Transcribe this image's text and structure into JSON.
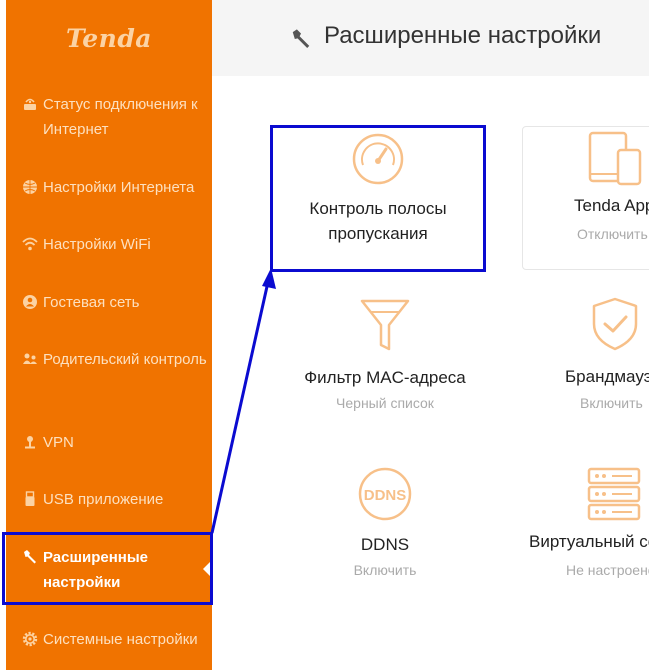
{
  "sidebar": {
    "logo": "Tenda",
    "items": [
      {
        "label": "Статус подключения к Интернет",
        "icon": "connection-status-icon"
      },
      {
        "label": "Настройки Интернета",
        "icon": "globe-icon"
      },
      {
        "label": "Настройки WiFi",
        "icon": "wifi-icon"
      },
      {
        "label": "Гостевая сеть",
        "icon": "guest-network-icon"
      },
      {
        "label": "Родительский контроль",
        "icon": "parental-control-icon"
      },
      {
        "label": "VPN",
        "icon": "vpn-icon"
      },
      {
        "label": "USB приложение",
        "icon": "usb-icon"
      },
      {
        "label": "Расширенные настройки",
        "icon": "wrench-icon",
        "active": true
      },
      {
        "label": "Системные настройки",
        "icon": "gear-icon"
      }
    ]
  },
  "header": {
    "title": "Расширенные настройки",
    "icon": "wrench-icon"
  },
  "tiles": [
    {
      "name_line1": "Контроль полосы",
      "name_line2": "пропускания",
      "status": "",
      "icon": "speedometer-icon"
    },
    {
      "name_line1": "Tenda App",
      "name_line2": "",
      "status": "Отключить",
      "icon": "devices-icon"
    },
    {
      "name_line1": "Фильтр MAC-адреса",
      "name_line2": "",
      "status": "Черный список",
      "icon": "funnel-icon"
    },
    {
      "name_line1": "Брандмауэр",
      "name_line2": "",
      "status": "Включить",
      "icon": "shield-check-icon"
    },
    {
      "name_line1": "DDNS",
      "name_line2": "",
      "status": "Включить",
      "icon": "ddns-icon",
      "icon_text": "DDNS"
    },
    {
      "name_line1": "Виртуальный сервер",
      "name_line2": "",
      "status": "Не настроено",
      "icon": "server-icon"
    }
  ],
  "colors": {
    "sidebar": "#f07300",
    "icon_accent": "#f7c089",
    "highlight": "#0b0bd0"
  }
}
